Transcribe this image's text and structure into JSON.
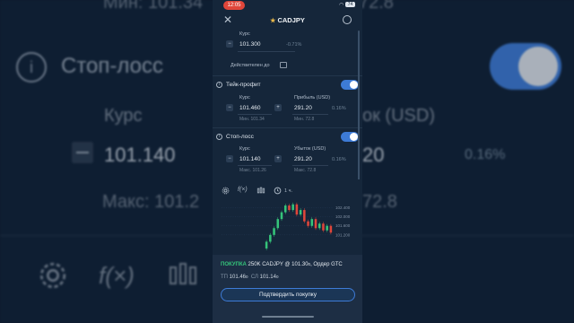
{
  "background": {
    "min_left": "Мин: 101.34",
    "min_right": "72.8",
    "section_title": "Стоп-лосс",
    "kurs_label": "Курс",
    "ubytok_label": "ок (USD)",
    "value_left": "101.140",
    "value_right": "20",
    "percent": "0.16%",
    "max_left": "Макс: 101.2",
    "max_right": "72.8"
  },
  "statusbar": {
    "time": "12:05",
    "battery": "74"
  },
  "header": {
    "symbol": "CADJPY"
  },
  "rate": {
    "label": "Курс",
    "value": "101.300",
    "change": "-0.71%",
    "valid_label": "Действителен до"
  },
  "take_profit": {
    "title": "Тейк-профит",
    "enabled": true,
    "rate_label": "Курс",
    "rate_value": "101.460",
    "rate_min": "Мин. 101.34",
    "profit_label": "Прибыль (USD)",
    "profit_value": "291.20",
    "profit_pct": "0.16%",
    "profit_min": "Мин. 72.8"
  },
  "stop_loss": {
    "title": "Стоп-лосс",
    "enabled": true,
    "rate_label": "Курс",
    "rate_value": "101.140",
    "rate_max": "Макс. 101.26",
    "loss_label": "Убыток (USD)",
    "loss_value": "291.20",
    "loss_pct": "0.16%",
    "loss_max": "Макс. 72.8"
  },
  "chart_toolbar": {
    "interval": "1 ч."
  },
  "chart_data": {
    "type": "candlestick",
    "y_ticks": [
      "102.400",
      "102.000",
      "101.600",
      "101.200"
    ],
    "candles": [
      {
        "o": 100.6,
        "c": 100.9,
        "dir": "up"
      },
      {
        "o": 100.9,
        "c": 101.2,
        "dir": "up"
      },
      {
        "o": 101.2,
        "c": 101.5,
        "dir": "up"
      },
      {
        "o": 101.5,
        "c": 101.9,
        "dir": "up"
      },
      {
        "o": 101.9,
        "c": 102.2,
        "dir": "up"
      },
      {
        "o": 102.2,
        "c": 102.5,
        "dir": "up"
      },
      {
        "o": 102.5,
        "c": 102.3,
        "dir": "down"
      },
      {
        "o": 102.3,
        "c": 102.55,
        "dir": "up"
      },
      {
        "o": 102.55,
        "c": 102.1,
        "dir": "down"
      },
      {
        "o": 102.1,
        "c": 102.3,
        "dir": "up"
      },
      {
        "o": 102.3,
        "c": 101.8,
        "dir": "down"
      },
      {
        "o": 101.8,
        "c": 101.6,
        "dir": "down"
      },
      {
        "o": 101.6,
        "c": 101.9,
        "dir": "up"
      },
      {
        "o": 101.9,
        "c": 101.5,
        "dir": "down"
      },
      {
        "o": 101.5,
        "c": 101.7,
        "dir": "up"
      },
      {
        "o": 101.7,
        "c": 101.4,
        "dir": "down"
      },
      {
        "o": 101.4,
        "c": 101.6,
        "dir": "up"
      },
      {
        "o": 101.6,
        "c": 101.3,
        "dir": "down"
      }
    ],
    "ylim": [
      100.4,
      102.7
    ]
  },
  "order": {
    "side": "ПОКУПКА",
    "details_pre": "250K CADJPY @ 101.30",
    "details_sub": "0",
    "details_post": ", Ордер GTC",
    "tp_label": "ТП",
    "tp_value": "101.46",
    "tp_sub": "0",
    "sl_label": "СЛ",
    "sl_value": "101.14",
    "sl_sub": "0",
    "confirm_label": "Подтвердить покупку"
  },
  "colors": {
    "accent": "#3d7bd6",
    "buy": "#35c47a",
    "sell": "#e0463a"
  }
}
